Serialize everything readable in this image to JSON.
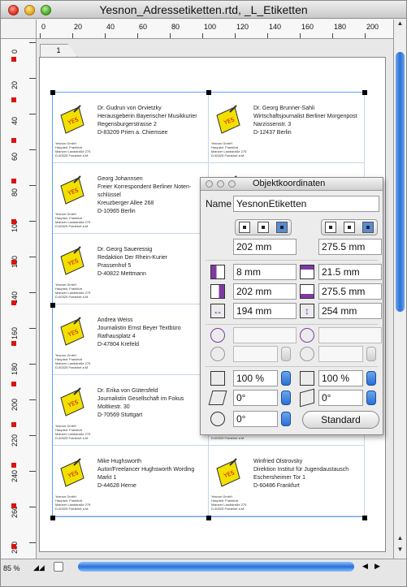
{
  "window": {
    "title": "Yesnon_Adressetiketten.rtd, _L_Etiketten"
  },
  "ruler": {
    "horizontal_ticks": [
      "0",
      "20",
      "40",
      "60",
      "80",
      "100",
      "120",
      "140",
      "160",
      "180",
      "200"
    ],
    "vertical_ticks": [
      "0",
      "20",
      "40",
      "60",
      "80",
      "100",
      "120",
      "140",
      "160",
      "180",
      "200",
      "220",
      "240",
      "260",
      "280"
    ]
  },
  "page_tab": "1",
  "labels": [
    {
      "lines": [
        "Dr. Gudrun von Orvietzky",
        "Herausgeberin Bayerischer Musikkurier",
        "Regensburgerstrasse 2",
        "D-83209 Prien a. Chiemsee"
      ]
    },
    {
      "lines": [
        "Dr. Georg Brunner-Sahli",
        "Wirtschaftsjournalist Berliner Morgenpost",
        "Narzissenstr. 3",
        "D-12437 Berlin"
      ]
    },
    {
      "lines": [
        "Georg Johannsen",
        "Freier Korrespondent Berliner Noten-",
        "schlüssel",
        "Kreuzberger Allee 268",
        "D-10965 Berlin"
      ]
    },
    {
      "lines": []
    },
    {
      "lines": [
        "Dr. Georg Saueressig",
        "Redaktion Der Rhein-Kurier",
        "Prassenhof 5",
        "D-40822 Mettmann"
      ]
    },
    {
      "lines": []
    },
    {
      "lines": [
        "Andrea Weiss",
        "Journalistin Ernst Beyer Textbüro",
        "Rathausplatz 4",
        "D-47804 Krefeld"
      ]
    },
    {
      "lines": []
    },
    {
      "lines": [
        "Dr. Erika von Gütersfeld",
        "Journalistin Gesellschaft im Fokus",
        "Moltkestr. 30",
        "D-70569 Stuttgart"
      ]
    },
    {
      "lines": []
    },
    {
      "lines": [
        "Mike Hughsworth",
        "Autor/Freelancer Hughsworth Wording",
        "Markt 1",
        "D-44628 Herne"
      ]
    },
    {
      "lines": [
        "Winfried Olstrovsky",
        "Direktion Institut für Jugendaustausch",
        "Eschersheimer Tor 1",
        "D-60486 Frankfurt"
      ]
    }
  ],
  "sender": {
    "lines": [
      "Yesnon GmbH",
      "Hauptstr. Frankfurt",
      "Mainzer Landstraße 275",
      "D-60325 Frankfurt a.M."
    ]
  },
  "zoom": "85 %",
  "panel": {
    "title": "Objektkoordinaten",
    "name_label": "Name",
    "name_value": "YesnonEtiketten",
    "width_value": "202 mm",
    "height_value": "275.5 mm",
    "left_value": "8 mm",
    "top_value": "21.5 mm",
    "right_value": "202 mm",
    "bottom_value": "275.5 mm",
    "hsize_value": "194 mm",
    "vsize_value": "254 mm",
    "hscale_value": "100 %",
    "vscale_value": "100 %",
    "hskew_value": "0°",
    "vskew_value": "0°",
    "rotation_value": "0°",
    "standard_button": "Standard"
  },
  "colors": {
    "accent": "#2a6fd6",
    "guide": "#5ea0ff",
    "logo_yellow": "#f2e000"
  }
}
